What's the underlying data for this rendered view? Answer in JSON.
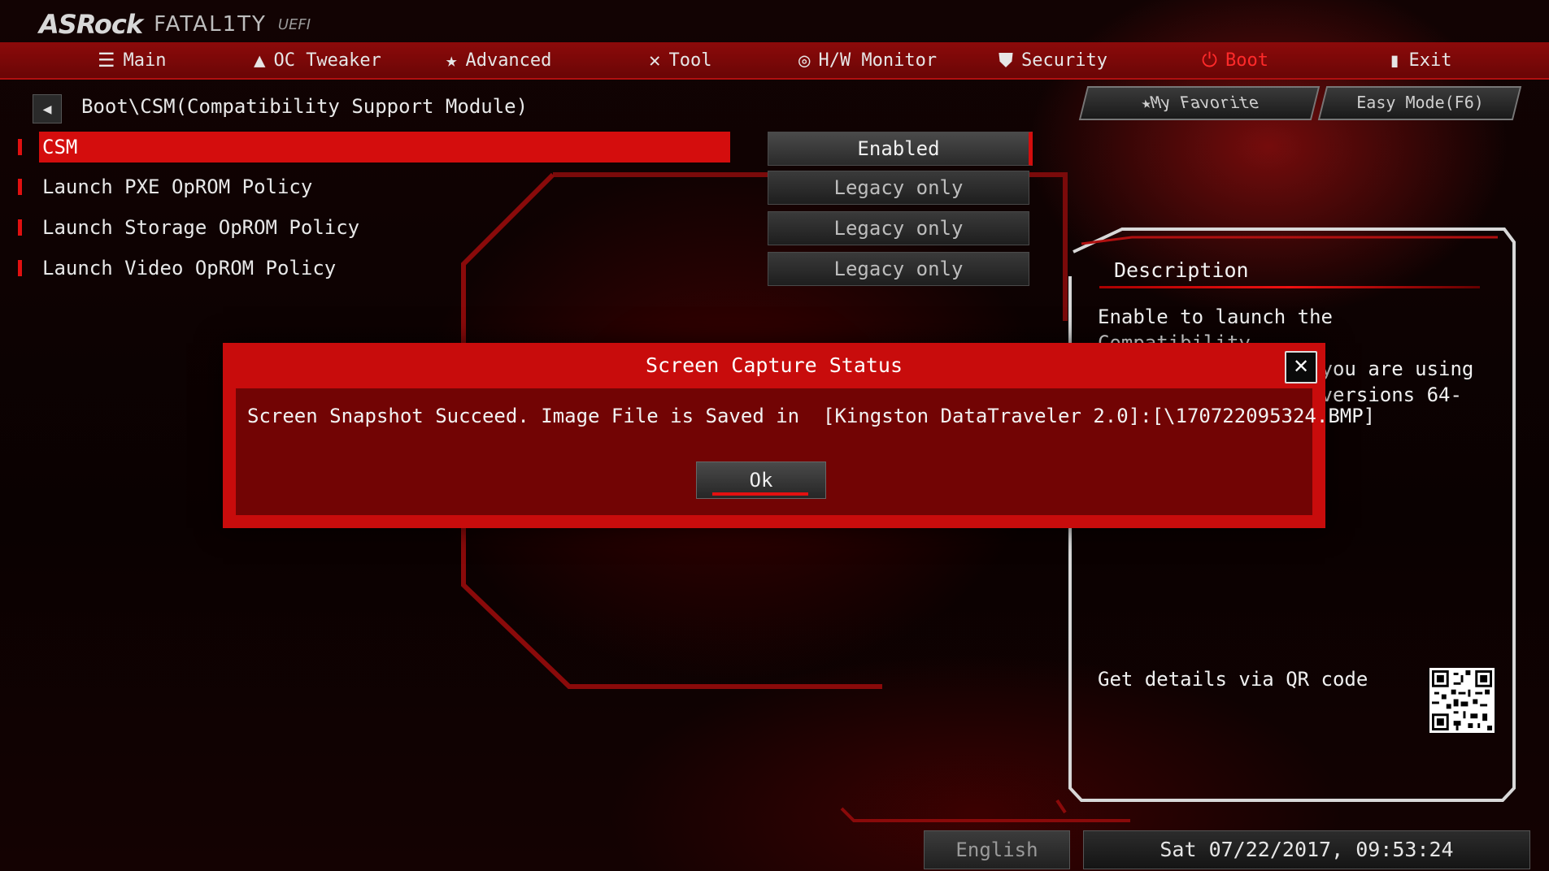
{
  "brand": {
    "asrock": "ASRock",
    "fatality": "FATAL1TY",
    "uefi": "UEFI"
  },
  "nav": {
    "items": [
      {
        "label": "Main",
        "icon": "list-icon"
      },
      {
        "label": "OC Tweaker",
        "icon": "rocket-icon"
      },
      {
        "label": "Advanced",
        "icon": "star-icon"
      },
      {
        "label": "Tool",
        "icon": "tools-icon"
      },
      {
        "label": "H/W Monitor",
        "icon": "monitor-icon"
      },
      {
        "label": "Security",
        "icon": "shield-icon"
      },
      {
        "label": "Boot",
        "icon": "power-icon"
      },
      {
        "label": "Exit",
        "icon": "exit-icon"
      }
    ],
    "active": "Boot"
  },
  "breadcrumb": "Boot\\CSM(Compatibility Support Module)",
  "settings": [
    {
      "label": "CSM",
      "value": "Enabled"
    },
    {
      "label": "Launch PXE OpROM Policy",
      "value": "Legacy only"
    },
    {
      "label": "Launch Storage OpROM Policy",
      "value": "Legacy only"
    },
    {
      "label": "Launch Video OpROM Policy",
      "value": "Legacy only"
    }
  ],
  "top_buttons": {
    "favorite": "My Favorite",
    "easy_mode": "Easy Mode(F6)"
  },
  "description": {
    "title": "Description",
    "text": "Enable to launch the Compatibility\nSupport Module. If you are using\nWindows 8 or later versions 64-bit\n... devices support\n... able CSM for",
    "qr_label": "Get details via QR code"
  },
  "footer": {
    "language": "English",
    "datetime": "Sat 07/22/2017, 09:53:24"
  },
  "dialog": {
    "title": "Screen Capture Status",
    "message": "Screen Snapshot Succeed. Image File is Saved in  [Kingston DataTraveler 2.0]:[\\170722095324.BMP]",
    "ok": "Ok",
    "close": "✕"
  },
  "colors": {
    "accent": "#d40d0d",
    "navbar": "#7a0808",
    "dialog": "#c80c0c",
    "dialog_body": "#720404"
  }
}
